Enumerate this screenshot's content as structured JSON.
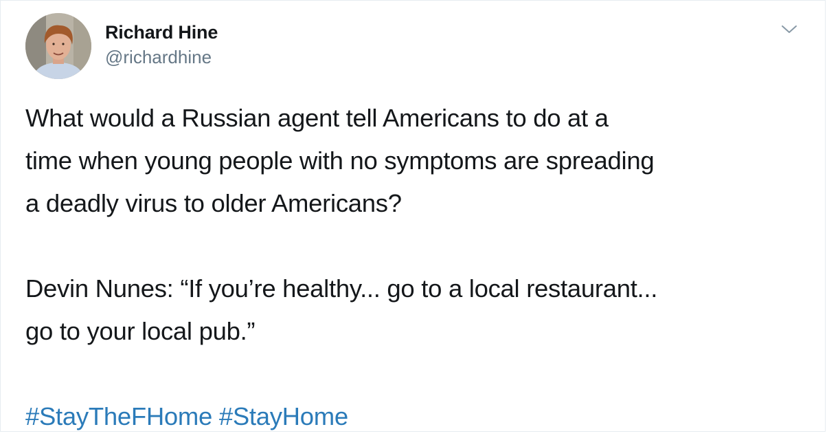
{
  "author": {
    "display_name": "Richard Hine",
    "handle": "@richardhine"
  },
  "icons": {
    "avatar": "profile-photo",
    "menu": "chevron-down-icon"
  },
  "tweet": {
    "paragraph_1": "What would a Russian agent tell Americans to do at a\ntime when young people with no symptoms are spreading\na deadly virus to older Americans?",
    "paragraph_2": "Devin Nunes: “If you’re healthy... go to a local restaurant...\ngo to your local pub.”",
    "hashtags": [
      "#StayTheFHome",
      "#StayHome"
    ]
  },
  "colors": {
    "text": "#14171a",
    "secondary": "#657786",
    "link": "#2b7bb9",
    "border": "#e6ecf0"
  }
}
